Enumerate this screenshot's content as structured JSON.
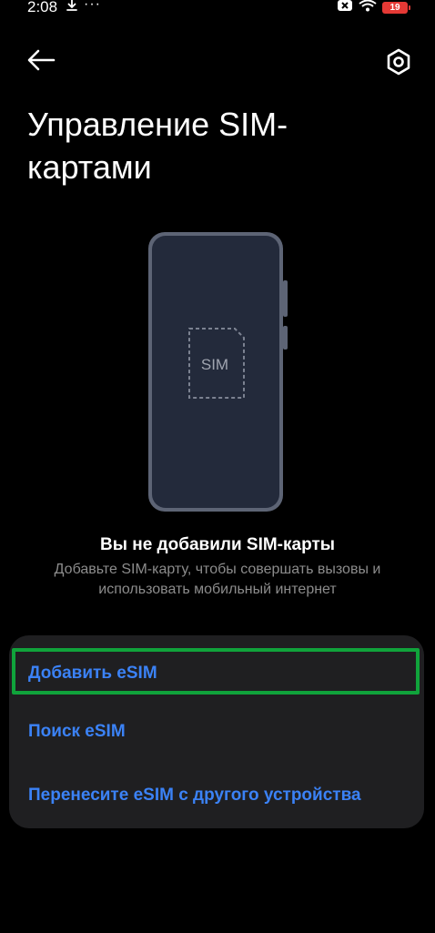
{
  "status_bar": {
    "time": "2:08",
    "more": "···",
    "battery": "19"
  },
  "header": {
    "back_icon": "arrow-left-icon",
    "settings_icon": "gear-hexagon-icon",
    "title": "Управление SIM-картами"
  },
  "illustration": {
    "sim_label": "SIM"
  },
  "empty_state": {
    "title": "Вы не добавили SIM-карты",
    "subtitle": "Добавьте SIM-карту, чтобы совершать вызовы и использовать мобильный интернет"
  },
  "actions": [
    {
      "label": "Добавить eSIM",
      "highlighted": true
    },
    {
      "label": "Поиск eSIM",
      "highlighted": false
    },
    {
      "label": "Перенесите eSIM с другого устройства",
      "highlighted": false
    }
  ],
  "colors": {
    "background": "#000000",
    "card": "#1f1f21",
    "accent": "#3b82f6",
    "highlight": "#10a33b",
    "battery": "#e53935"
  }
}
